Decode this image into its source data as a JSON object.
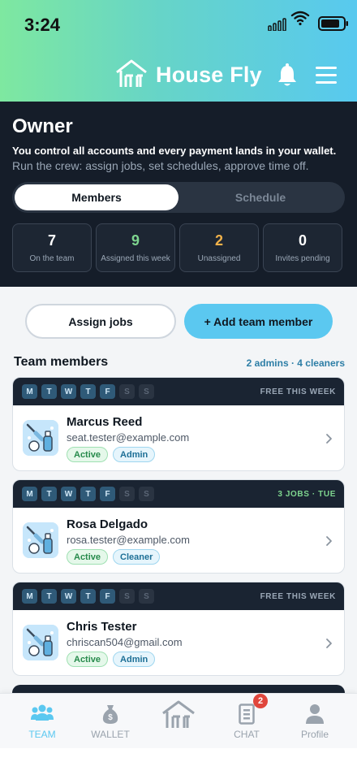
{
  "status_bar": {
    "time": "3:24"
  },
  "header": {
    "logo_text": "House Fly"
  },
  "owner": {
    "title": "Owner",
    "description": "You control all accounts and every payment lands in your wallet.",
    "subtitle": "Run the crew: assign jobs, set schedules, approve time off.",
    "tabs": [
      {
        "label": "Members",
        "active": true
      },
      {
        "label": "Schedule",
        "active": false
      }
    ],
    "stats": [
      {
        "value": "7",
        "label": "On the team",
        "color": "#ffffff"
      },
      {
        "value": "9",
        "label": "Assigned this week",
        "color": "#7ed58f"
      },
      {
        "value": "2",
        "label": "Unassigned",
        "color": "#f2b24a"
      },
      {
        "value": "0",
        "label": "Invites pending",
        "color": "#ffffff"
      }
    ]
  },
  "actions": {
    "assign_label": "Assign jobs",
    "add_label": "+ Add team member"
  },
  "team": {
    "heading": "Team members",
    "meta": "2 admins · 4 cleaners",
    "members": [
      {
        "name": "Marcus Reed",
        "email": "seat.tester@example.com",
        "status": "Active",
        "role": "Admin",
        "days": [
          "M",
          "T",
          "W",
          "T",
          "F",
          "S",
          "S"
        ],
        "bar_status": "FREE THIS WEEK"
      },
      {
        "name": "Rosa Delgado",
        "email": "rosa.tester@example.com",
        "status": "Active",
        "role": "Cleaner",
        "days": [
          "M",
          "T",
          "W",
          "T",
          "F",
          "S",
          "S"
        ],
        "bar_status": "3 JOBS · TUE"
      },
      {
        "name": "Chris Tester",
        "email": "chriscan504@gmail.com",
        "status": "Active",
        "role": "Admin",
        "days": [
          "M",
          "T",
          "W",
          "T",
          "F",
          "S",
          "S"
        ],
        "bar_status": "FREE THIS WEEK"
      }
    ]
  },
  "tabbar": {
    "items": [
      {
        "label": "TEAM",
        "icon": "team-icon"
      },
      {
        "label": "WALLET",
        "icon": "wallet-icon"
      },
      {
        "label": "",
        "icon": "house-icon"
      },
      {
        "label": "CHAT",
        "icon": "chat-icon",
        "badge": "2"
      },
      {
        "label": "Profile",
        "icon": "profile-icon"
      }
    ]
  },
  "colors": {
    "accent": "#5bc8f0",
    "dark_panel": "#151d29",
    "green": "#7ed58f",
    "orange": "#f2b24a"
  }
}
